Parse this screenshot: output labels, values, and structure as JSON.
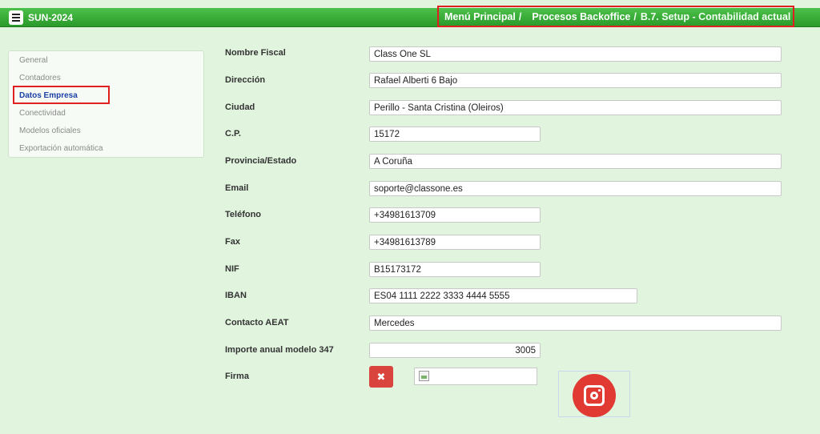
{
  "app": {
    "title": "SUN-2024"
  },
  "breadcrumb": {
    "items": [
      "Menú Principal",
      "Procesos Backoffice",
      "B.7. Setup - Contabilidad actual"
    ],
    "separator": "/"
  },
  "sidebar": {
    "items": [
      {
        "label": "General",
        "active": false
      },
      {
        "label": "Contadores",
        "active": false
      },
      {
        "label": "Datos Empresa",
        "active": true
      },
      {
        "label": "Conectividad",
        "active": false
      },
      {
        "label": "Modelos oficiales",
        "active": false
      },
      {
        "label": "Exportación automática",
        "active": false
      }
    ]
  },
  "form": {
    "fields": [
      {
        "label": "Nombre Fiscal",
        "value": "Class One SL"
      },
      {
        "label": "Dirección",
        "value": "Rafael Alberti 6 Bajo"
      },
      {
        "label": "Ciudad",
        "value": "Perillo - Santa Cristina (Oleiros)"
      },
      {
        "label": "C.P.",
        "value": "15172"
      },
      {
        "label": "Provincia/Estado",
        "value": "A Coruña"
      },
      {
        "label": "Email",
        "value": "soporte@classone.es"
      },
      {
        "label": "Teléfono",
        "value": "+34981613709"
      },
      {
        "label": "Fax",
        "value": "+34981613789"
      },
      {
        "label": "NIF",
        "value": "B15173172"
      },
      {
        "label": "IBAN",
        "value": "ES04 1111 2222 3333 4444 5555"
      },
      {
        "label": "Contacto AEAT",
        "value": "Mercedes"
      },
      {
        "label": "Importe anual modelo 347",
        "value": "3005"
      }
    ],
    "firma": {
      "label": "Firma",
      "delete_icon": "x-icon",
      "image_icon": "broken-image-icon",
      "logo_icon": "instagram-icon"
    }
  },
  "colors": {
    "topbar": "#3aab38",
    "background": "#e0f4de",
    "highlight": "#e02020",
    "delete": "#d9443e",
    "active_link": "#1a3fa8"
  }
}
